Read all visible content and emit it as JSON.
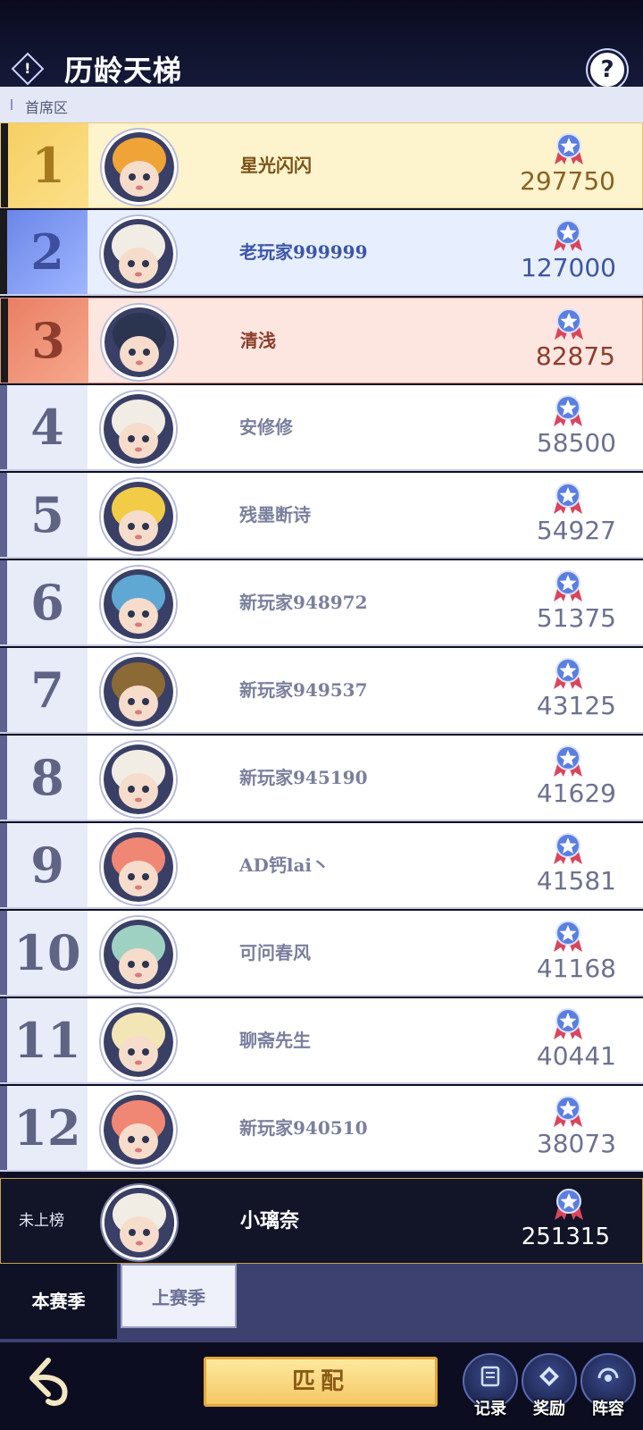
{
  "header": {
    "title": "历龄天梯",
    "help_icon": "question-icon",
    "alert_icon": "exclamation-diamond-icon"
  },
  "section": {
    "label": "首席区"
  },
  "colors": {
    "gold": "#f6cf62",
    "silver": "#6b86e8",
    "bronze": "#ea7f64",
    "match_button": "#f5c766"
  },
  "leaderboard": [
    {
      "rank": "1",
      "name": "星光闪闪",
      "score": "297750",
      "tier": "gold",
      "avatar": "#f0a437"
    },
    {
      "rank": "2",
      "name": "老玩家999999",
      "score": "127000",
      "tier": "silver",
      "avatar": "#f1ede4"
    },
    {
      "rank": "3",
      "name": "清浅",
      "score": "82875",
      "tier": "bronze",
      "avatar": "#2c3550"
    },
    {
      "rank": "4",
      "name": "安修修",
      "score": "58500",
      "tier": "normal",
      "avatar": "#f1ede4"
    },
    {
      "rank": "5",
      "name": "残墨断诗",
      "score": "54927",
      "tier": "normal",
      "avatar": "#f2cc46"
    },
    {
      "rank": "6",
      "name": "新玩家948972",
      "score": "51375",
      "tier": "normal",
      "avatar": "#5fa8d4"
    },
    {
      "rank": "7",
      "name": "新玩家949537",
      "score": "43125",
      "tier": "normal",
      "avatar": "#8c6a36"
    },
    {
      "rank": "8",
      "name": "新玩家945190",
      "score": "41629",
      "tier": "normal",
      "avatar": "#f1ede4"
    },
    {
      "rank": "9",
      "name": "AD钙lai丶",
      "score": "41581",
      "tier": "normal",
      "avatar": "#f08774"
    },
    {
      "rank": "10",
      "name": "可问春风",
      "score": "41168",
      "tier": "normal",
      "avatar": "#9ed1c2"
    },
    {
      "rank": "11",
      "name": "聊斋先生",
      "score": "40441",
      "tier": "normal",
      "avatar": "#f3e6b6"
    },
    {
      "rank": "12",
      "name": "新玩家940510",
      "score": "38073",
      "tier": "normal",
      "avatar": "#f08774"
    }
  ],
  "my_entry": {
    "status": "未上榜",
    "name": "小璃奈",
    "score": "251315",
    "avatar": "#f1ede4"
  },
  "tabs": [
    {
      "label": "本赛季",
      "active": true
    },
    {
      "label": "上赛季",
      "active": false
    }
  ],
  "bottom": {
    "back_icon": "back-arrow-icon",
    "match_label": "匹配",
    "buttons": [
      {
        "label": "记录",
        "icon": "record-icon"
      },
      {
        "label": "奖励",
        "icon": "reward-icon"
      },
      {
        "label": "阵容",
        "icon": "lineup-icon"
      }
    ]
  }
}
